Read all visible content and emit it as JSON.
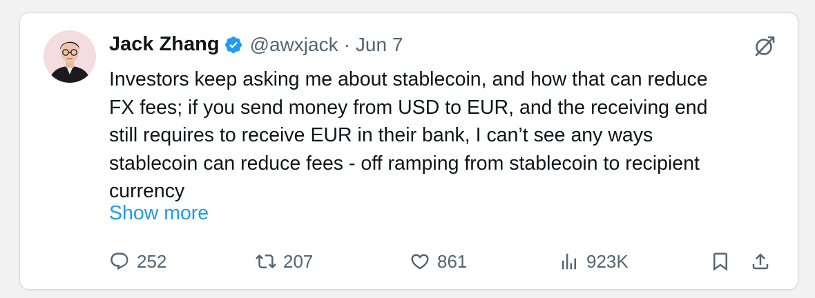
{
  "tweet": {
    "author": {
      "name": "Jack Zhang",
      "handle": "@awxjack",
      "verified_color": "#1d9bf0"
    },
    "separator": "·",
    "date": "Jun 7",
    "text_lines": [
      "Investors keep asking me about stablecoin, and how that can reduce",
      "FX fees; if you send money from USD to EUR, and the receiving end",
      "still requires to receive EUR in their bank, I can’t see any ways",
      "stablecoin can reduce fees - off ramping from stablecoin to recipient",
      "currency"
    ],
    "show_more": "Show more",
    "actions": {
      "replies": "252",
      "reposts": "207",
      "likes": "861",
      "views": "923K"
    },
    "icons": {
      "reply": "reply-icon",
      "repost": "repost-icon",
      "like": "heart-icon",
      "views": "views-icon",
      "bookmark": "bookmark-icon",
      "share": "share-icon",
      "grok": "grok-icon",
      "verified": "verified-badge-icon"
    },
    "colors": {
      "text": "#0f1419",
      "secondary": "#536471",
      "link": "#1d9bf0"
    }
  }
}
